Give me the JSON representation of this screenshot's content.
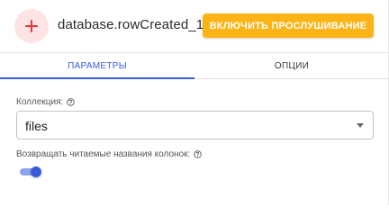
{
  "node": {
    "icon": "plus-icon",
    "title": "database.rowCreated_1",
    "listen_button_label": "ВКЛЮЧИТЬ ПРОСЛУШИВАНИЕ"
  },
  "tabs": [
    {
      "label": "ПАРАМЕТРЫ",
      "active": true
    },
    {
      "label": "ОПЦИИ",
      "active": false
    }
  ],
  "form": {
    "collection": {
      "label": "Коллекция:",
      "help_icon": "help-circle-icon",
      "value": "files"
    },
    "readable_columns": {
      "label": "Возвращать читаемые названия колонок:",
      "help_icon": "help-circle-icon",
      "enabled": true
    }
  },
  "colors": {
    "accent": "#3a5bd9",
    "button": "#fcb316",
    "icon_bg": "#fde3e3",
    "icon_fg": "#e53935"
  }
}
